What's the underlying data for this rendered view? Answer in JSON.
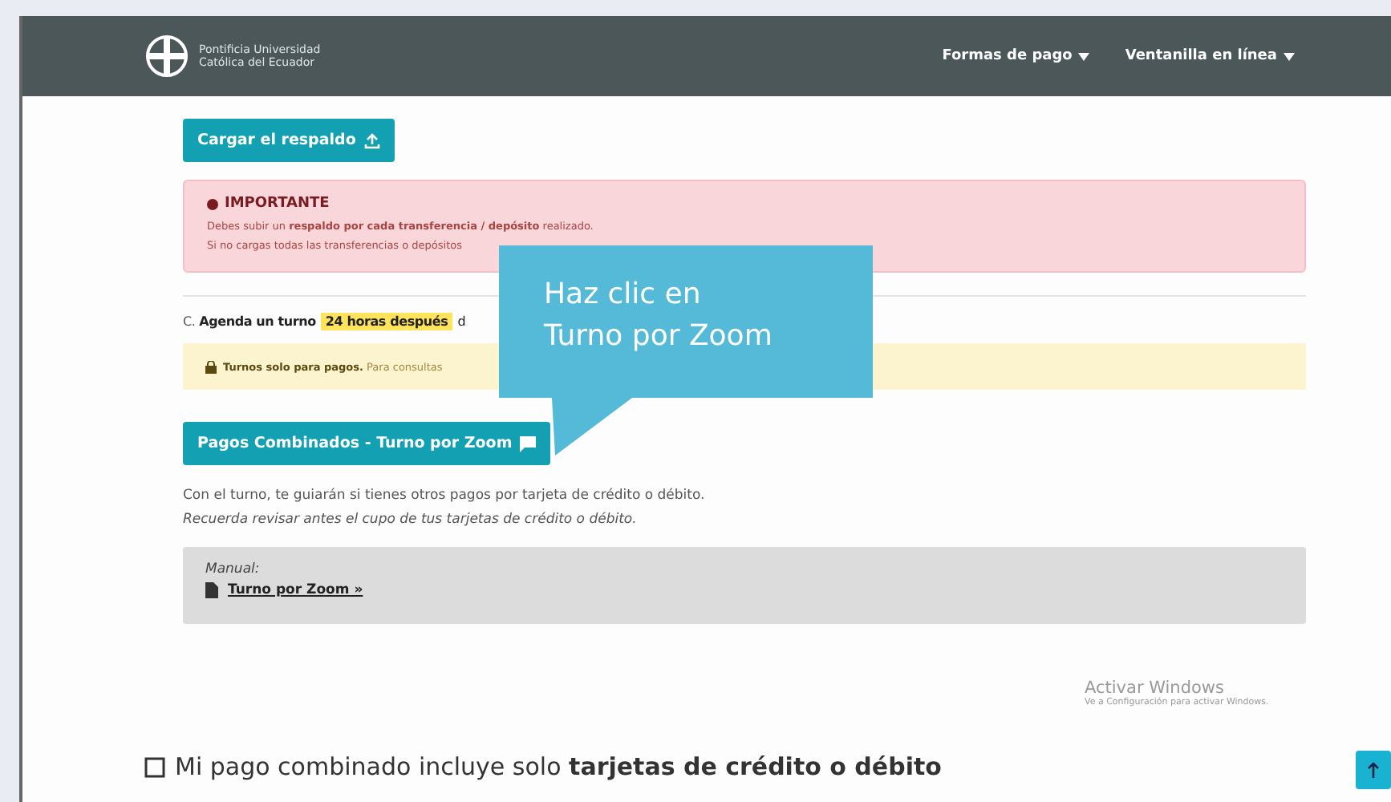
{
  "header": {
    "logo_lines": [
      "Pontificia Universidad",
      "Católica del Ecuador"
    ],
    "nav": [
      {
        "label": "Formas de pago"
      },
      {
        "label": "Ventanilla en línea"
      }
    ]
  },
  "upload_button": "Cargar el respaldo",
  "important": {
    "title": "IMPORTANTE",
    "lines": [
      "Debes subir un **respaldo por cada transferencia / depósito** realizado.",
      "Si no cargas todas las transferencias o depósitos"
    ]
  },
  "schedule": {
    "prefix": "C.",
    "label": "Agenda un turno",
    "highlight": "24 horas después",
    "rest": "d"
  },
  "notice": {
    "bold": "Turnos solo para pagos.",
    "text": "Para consultas"
  },
  "zoom_button": "Pagos Combinados - Turno por Zoom",
  "info_lines": [
    "Con el turno, te guiarán si tienes otros pagos por tarjeta de crédito o débito.",
    "Recuerda revisar antes el cupo de tus tarjetas de crédito o débito."
  ],
  "manual": {
    "label": "Manual:",
    "link": "Turno por Zoom »"
  },
  "callout": {
    "lines": [
      "Haz clic en",
      "Turno por Zoom"
    ]
  },
  "os_notice": {
    "title": "Activar Windows",
    "text": "Ve a Configuración para activar Windows."
  },
  "bottom_option": "Mi pago combinado incluye solo **tarjetas de crédito o débito**"
}
